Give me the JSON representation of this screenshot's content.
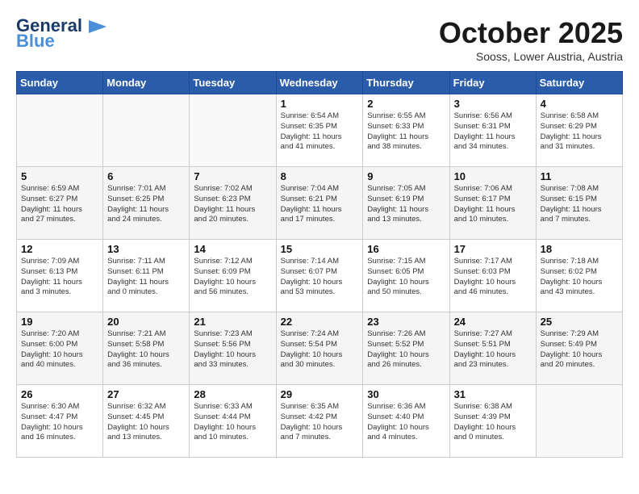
{
  "logo": {
    "line1": "General",
    "line2": "Blue"
  },
  "title": "October 2025",
  "location": "Sooss, Lower Austria, Austria",
  "days_of_week": [
    "Sunday",
    "Monday",
    "Tuesday",
    "Wednesday",
    "Thursday",
    "Friday",
    "Saturday"
  ],
  "weeks": [
    [
      {
        "day": "",
        "info": ""
      },
      {
        "day": "",
        "info": ""
      },
      {
        "day": "",
        "info": ""
      },
      {
        "day": "1",
        "info": "Sunrise: 6:54 AM\nSunset: 6:35 PM\nDaylight: 11 hours\nand 41 minutes."
      },
      {
        "day": "2",
        "info": "Sunrise: 6:55 AM\nSunset: 6:33 PM\nDaylight: 11 hours\nand 38 minutes."
      },
      {
        "day": "3",
        "info": "Sunrise: 6:56 AM\nSunset: 6:31 PM\nDaylight: 11 hours\nand 34 minutes."
      },
      {
        "day": "4",
        "info": "Sunrise: 6:58 AM\nSunset: 6:29 PM\nDaylight: 11 hours\nand 31 minutes."
      }
    ],
    [
      {
        "day": "5",
        "info": "Sunrise: 6:59 AM\nSunset: 6:27 PM\nDaylight: 11 hours\nand 27 minutes."
      },
      {
        "day": "6",
        "info": "Sunrise: 7:01 AM\nSunset: 6:25 PM\nDaylight: 11 hours\nand 24 minutes."
      },
      {
        "day": "7",
        "info": "Sunrise: 7:02 AM\nSunset: 6:23 PM\nDaylight: 11 hours\nand 20 minutes."
      },
      {
        "day": "8",
        "info": "Sunrise: 7:04 AM\nSunset: 6:21 PM\nDaylight: 11 hours\nand 17 minutes."
      },
      {
        "day": "9",
        "info": "Sunrise: 7:05 AM\nSunset: 6:19 PM\nDaylight: 11 hours\nand 13 minutes."
      },
      {
        "day": "10",
        "info": "Sunrise: 7:06 AM\nSunset: 6:17 PM\nDaylight: 11 hours\nand 10 minutes."
      },
      {
        "day": "11",
        "info": "Sunrise: 7:08 AM\nSunset: 6:15 PM\nDaylight: 11 hours\nand 7 minutes."
      }
    ],
    [
      {
        "day": "12",
        "info": "Sunrise: 7:09 AM\nSunset: 6:13 PM\nDaylight: 11 hours\nand 3 minutes."
      },
      {
        "day": "13",
        "info": "Sunrise: 7:11 AM\nSunset: 6:11 PM\nDaylight: 11 hours\nand 0 minutes."
      },
      {
        "day": "14",
        "info": "Sunrise: 7:12 AM\nSunset: 6:09 PM\nDaylight: 10 hours\nand 56 minutes."
      },
      {
        "day": "15",
        "info": "Sunrise: 7:14 AM\nSunset: 6:07 PM\nDaylight: 10 hours\nand 53 minutes."
      },
      {
        "day": "16",
        "info": "Sunrise: 7:15 AM\nSunset: 6:05 PM\nDaylight: 10 hours\nand 50 minutes."
      },
      {
        "day": "17",
        "info": "Sunrise: 7:17 AM\nSunset: 6:03 PM\nDaylight: 10 hours\nand 46 minutes."
      },
      {
        "day": "18",
        "info": "Sunrise: 7:18 AM\nSunset: 6:02 PM\nDaylight: 10 hours\nand 43 minutes."
      }
    ],
    [
      {
        "day": "19",
        "info": "Sunrise: 7:20 AM\nSunset: 6:00 PM\nDaylight: 10 hours\nand 40 minutes."
      },
      {
        "day": "20",
        "info": "Sunrise: 7:21 AM\nSunset: 5:58 PM\nDaylight: 10 hours\nand 36 minutes."
      },
      {
        "day": "21",
        "info": "Sunrise: 7:23 AM\nSunset: 5:56 PM\nDaylight: 10 hours\nand 33 minutes."
      },
      {
        "day": "22",
        "info": "Sunrise: 7:24 AM\nSunset: 5:54 PM\nDaylight: 10 hours\nand 30 minutes."
      },
      {
        "day": "23",
        "info": "Sunrise: 7:26 AM\nSunset: 5:52 PM\nDaylight: 10 hours\nand 26 minutes."
      },
      {
        "day": "24",
        "info": "Sunrise: 7:27 AM\nSunset: 5:51 PM\nDaylight: 10 hours\nand 23 minutes."
      },
      {
        "day": "25",
        "info": "Sunrise: 7:29 AM\nSunset: 5:49 PM\nDaylight: 10 hours\nand 20 minutes."
      }
    ],
    [
      {
        "day": "26",
        "info": "Sunrise: 6:30 AM\nSunset: 4:47 PM\nDaylight: 10 hours\nand 16 minutes."
      },
      {
        "day": "27",
        "info": "Sunrise: 6:32 AM\nSunset: 4:45 PM\nDaylight: 10 hours\nand 13 minutes."
      },
      {
        "day": "28",
        "info": "Sunrise: 6:33 AM\nSunset: 4:44 PM\nDaylight: 10 hours\nand 10 minutes."
      },
      {
        "day": "29",
        "info": "Sunrise: 6:35 AM\nSunset: 4:42 PM\nDaylight: 10 hours\nand 7 minutes."
      },
      {
        "day": "30",
        "info": "Sunrise: 6:36 AM\nSunset: 4:40 PM\nDaylight: 10 hours\nand 4 minutes."
      },
      {
        "day": "31",
        "info": "Sunrise: 6:38 AM\nSunset: 4:39 PM\nDaylight: 10 hours\nand 0 minutes."
      },
      {
        "day": "",
        "info": ""
      }
    ]
  ]
}
